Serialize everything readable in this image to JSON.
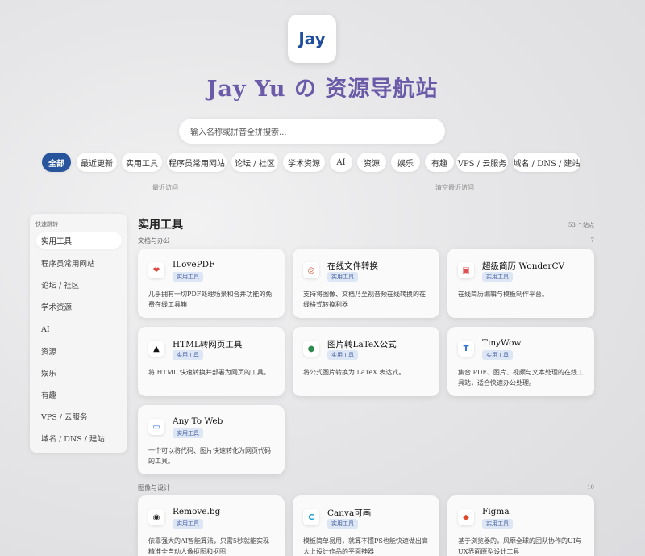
{
  "header": {
    "logo_text": "Jay",
    "logo_accent": "ˆ",
    "title": "Jay Yu の 资源导航站"
  },
  "search": {
    "placeholder": "输入名称或拼音全拼搜索..."
  },
  "categories": [
    "全部",
    "最近更新",
    "实用工具",
    "程序员常用网站",
    "论坛 / 社区",
    "学术资源",
    "AI",
    "资源",
    "娱乐",
    "有趣",
    "VPS / 云服务",
    "域名 / DNS / 建站"
  ],
  "hints": {
    "recent": "最近访问",
    "clear": "清空最近访问"
  },
  "sidebar": {
    "title": "快速跳转",
    "items": [
      "实用工具",
      "程序员常用网站",
      "论坛 / 社区",
      "学术资源",
      "AI",
      "资源",
      "娱乐",
      "有趣",
      "VPS / 云服务",
      "域名 / DNS / 建站"
    ]
  },
  "section": {
    "title": "实用工具",
    "count": "53 个站点"
  },
  "groups": [
    {
      "label": "文档与办公",
      "count": "7"
    },
    {
      "label": "图像与设计",
      "count": "10"
    }
  ],
  "cards": [
    {
      "name": "ILovePDF",
      "tag": "实用工具",
      "desc": "几乎拥有一切PDF处理场景和合并功能的免费在线工具箱",
      "icon": "heart-icon",
      "icon_glyph": "❤",
      "icon_color": "#e0443a"
    },
    {
      "name": "在线文件转换",
      "tag": "实用工具",
      "desc": "支持将图像、文档乃至视音频在线转换的在线格式转换利器",
      "icon": "convert-icon",
      "icon_glyph": "◎",
      "icon_color": "#d9452e"
    },
    {
      "name": "超级简历 WonderCV",
      "tag": "实用工具",
      "desc": "在线简历编辑与模板制作平台。",
      "icon": "resume-icon",
      "icon_glyph": "▣",
      "icon_color": "#e05050"
    },
    {
      "name": "HTML转网页工具",
      "tag": "实用工具",
      "desc": "将 HTML 快速转换并部署为网页的工具。",
      "icon": "html-icon",
      "icon_glyph": "▲",
      "icon_color": "#111111"
    },
    {
      "name": "图片转LaTeX公式",
      "tag": "实用工具",
      "desc": "将公式图片转换为 LaTeX 表达式。",
      "icon": "latex-icon",
      "icon_glyph": "●",
      "icon_color": "#2e8a4e"
    },
    {
      "name": "TinyWow",
      "tag": "实用工具",
      "desc": "集合 PDF、图片、视频与文本处理的在线工具站，适合快速办公处理。",
      "icon": "tinywow-icon",
      "icon_glyph": "T",
      "icon_color": "#2f6fd6"
    },
    {
      "name": "Any To Web",
      "tag": "实用工具",
      "desc": "一个可以将代码、图片快速转化为网页代码的工具。",
      "icon": "anytoweb-icon",
      "icon_glyph": "▭",
      "icon_color": "#3a6fd0"
    },
    {
      "name": "Remove.bg",
      "tag": "实用工具",
      "desc": "依靠强大的AI智能算法，只需5秒就能实现精准全自动人像抠图和抠图",
      "icon": "removebg-icon",
      "icon_glyph": "◉",
      "icon_color": "#2b2b2b"
    },
    {
      "name": "Canva可画",
      "tag": "实用工具",
      "desc": "模板简单易用，就算不懂PS也能快速做出高大上设计作品的平面神器",
      "icon": "canva-icon",
      "icon_glyph": "C",
      "icon_color": "#1fa2d6"
    },
    {
      "name": "Figma",
      "tag": "实用工具",
      "desc": "基于浏览器的，风靡全球的团队协作的UI与UX界面原型设计工具",
      "icon": "figma-icon",
      "icon_glyph": "◆",
      "icon_color": "#e24a2e"
    }
  ],
  "colors": {
    "accent": "#27549c",
    "title": "#6a5aa8",
    "tag_bg": "#dde6f4"
  }
}
